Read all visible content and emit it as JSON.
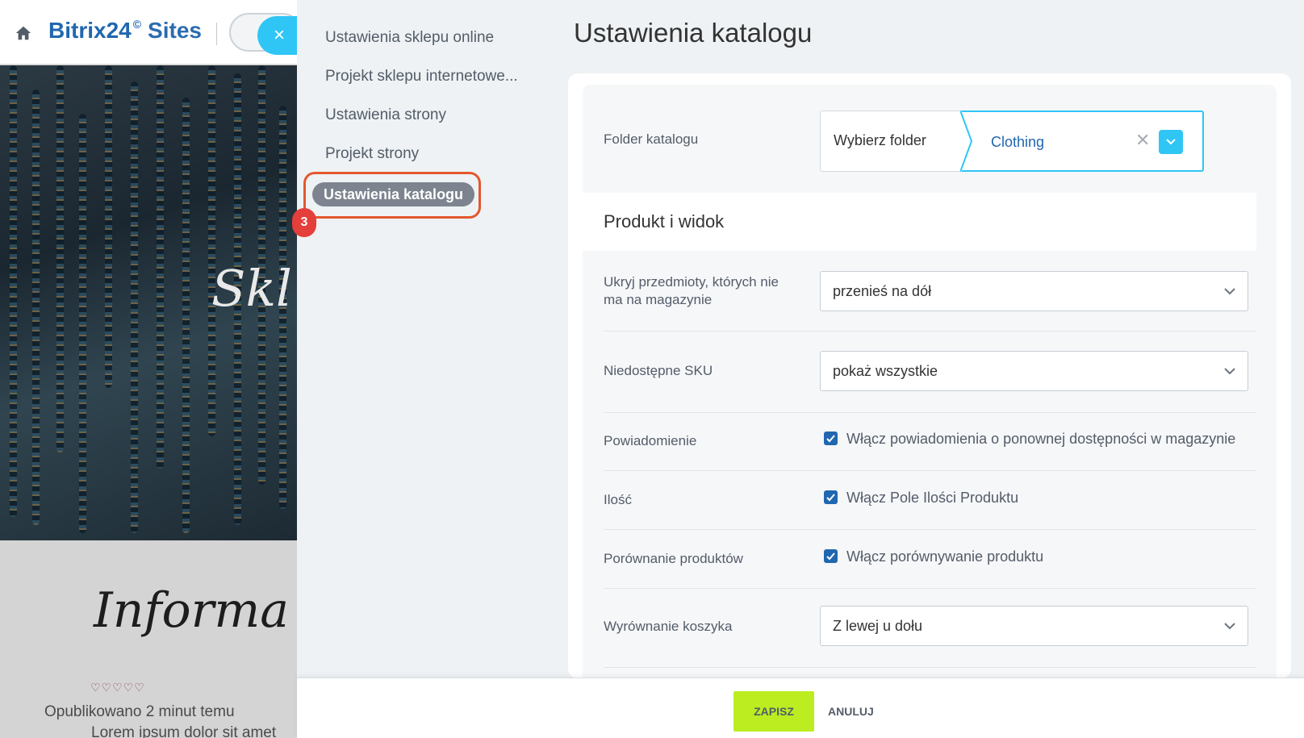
{
  "background": {
    "brand_name": "Bitrix24",
    "brand_mark": "©",
    "brand_product": "Sites",
    "hero_title": "Skl",
    "info_heading": "Informa",
    "hearts": "♡♡♡♡♡",
    "published": "Opublikowano 2 minut temu",
    "lorem": "Lorem ipsum dolor sit amet"
  },
  "close_button": {
    "icon": "close-icon",
    "glyph": "×"
  },
  "menu": {
    "items": [
      {
        "label": "Ustawienia sklepu online"
      },
      {
        "label": "Projekt sklepu internetowe..."
      },
      {
        "label": "Ustawienia strony"
      },
      {
        "label": "Projekt strony"
      }
    ],
    "active_label": "Ustawienia katalogu",
    "step_badge": "3"
  },
  "page_title": "Ustawienia katalogu",
  "form": {
    "folder": {
      "label": "Folder katalogu",
      "picker_label": "Wybierz folder",
      "value": "Clothing",
      "clear_glyph": "✕"
    },
    "section_title": "Produkt i widok",
    "hide_items": {
      "label": "Ukryj przedmioty, których nie ma na magazynie",
      "value": "przenieś na dół"
    },
    "sku": {
      "label": "Niedostępne SKU",
      "value": "pokaż wszystkie"
    },
    "notification": {
      "label": "Powiadomienie",
      "checkbox_label": "Włącz powiadomienia o ponownej dostępności w magazynie",
      "checked": true
    },
    "quantity": {
      "label": "Ilość",
      "checkbox_label": "Włącz Pole Ilości Produktu",
      "checked": true
    },
    "compare": {
      "label": "Porównanie produktów",
      "checkbox_label": "Włącz porównywanie produktu",
      "checked": true
    },
    "cart_align": {
      "label": "Wyrównanie koszyka",
      "value": "Z lewej u dołu"
    }
  },
  "footer": {
    "save_label": "ZAPISZ",
    "cancel_label": "ANULUJ"
  },
  "colors": {
    "accent": "#2fc6f6",
    "save": "#bbed21",
    "highlight": "#e4572e",
    "badge": "#e43f3a",
    "checkbox": "#2067b0"
  }
}
